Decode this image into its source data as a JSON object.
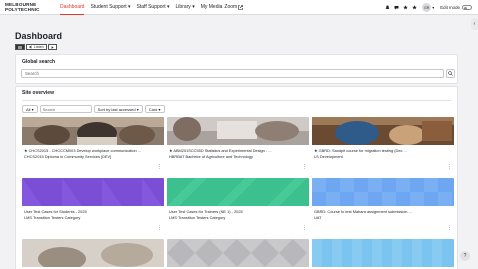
{
  "nav": {
    "logo_line1": "MELBOURNE",
    "logo_line2": "POLYTECHNIC",
    "items": [
      {
        "label": "Dashboard"
      },
      {
        "label": "Student Support ▾"
      },
      {
        "label": "Staff Support ▾"
      },
      {
        "label": "Library ▾"
      },
      {
        "label": "My Media"
      },
      {
        "label": "Zoom"
      }
    ],
    "avatar_initials": "GR",
    "edit_mode_label": "Edit mode"
  },
  "page": {
    "title": "Dashboard",
    "tts_listen": "Listen"
  },
  "global_search": {
    "title": "Global search",
    "placeholder": "Search"
  },
  "site_overview": {
    "title": "Site overview",
    "filter_all": "All",
    "search_placeholder": "Search",
    "sort_label": "Sort by last accessed",
    "view_label": "Card",
    "courses": [
      {
        "title": "★ CHCS2015 - CHCCCM003 Develop workplace communication ...",
        "category": "CHCS2015 Diploma in Community Services [DEV]"
      },
      {
        "title": "★ ABM201SCC55D Statistics and Experimental Design - ...",
        "category": "HBRBAT Bachelor of Agriculture and Technology"
      },
      {
        "title": "★ GBRD: Sandpit course for migration testing (Dec ...",
        "category": "LS Development"
      },
      {
        "title": "User Test Cases for Students - 2025",
        "category": "LMS Transition Testers Category"
      },
      {
        "title": "User Test Cases for Trainers (NE 1) - 2025",
        "category": "LMS Transition Testers Category"
      },
      {
        "title": "GBRD: Course to test Mahara assignment submission ...",
        "category": "UAT"
      }
    ]
  },
  "colors": {
    "accent": "#e7362b",
    "purple": "#7a4fd6",
    "green": "#3cc08f",
    "blue": "#6ea6f2"
  }
}
